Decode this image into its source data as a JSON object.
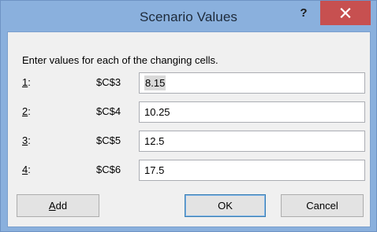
{
  "dialog": {
    "title": "Scenario Values",
    "help_label": "?",
    "instruction": "Enter values for each of the changing cells.",
    "rows": [
      {
        "num": "1",
        "suffix": ":",
        "cell": "$C$3",
        "value": "8.15"
      },
      {
        "num": "2",
        "suffix": ":",
        "cell": "$C$4",
        "value": "10.25"
      },
      {
        "num": "3",
        "suffix": ":",
        "cell": "$C$5",
        "value": "12.5"
      },
      {
        "num": "4",
        "suffix": ":",
        "cell": "$C$6",
        "value": "17.5"
      }
    ],
    "buttons": {
      "add_key": "A",
      "add_rest": "dd",
      "ok": "OK",
      "cancel": "Cancel"
    }
  },
  "colors": {
    "frame": "#8ab0dd",
    "close": "#c75050",
    "client": "#f0f0f0"
  }
}
